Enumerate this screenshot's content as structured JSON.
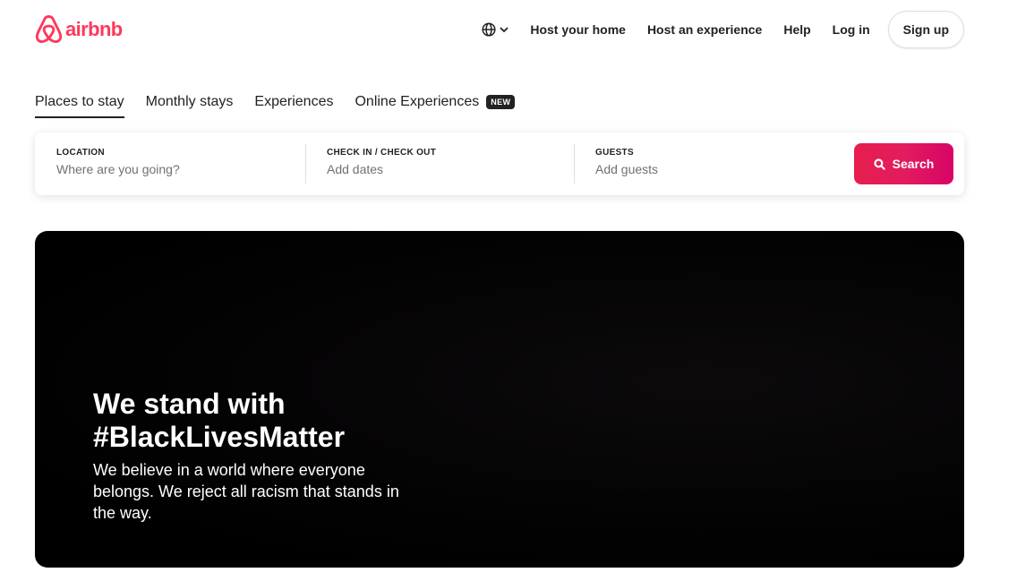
{
  "brand": {
    "name": "airbnb",
    "color": "#ff385c"
  },
  "header": {
    "language_icon": "globe-icon",
    "language_chevron_icon": "chevron-down-icon",
    "links": [
      "Host your home",
      "Host an experience",
      "Help",
      "Log in"
    ],
    "signup_label": "Sign up"
  },
  "tabs": {
    "items": [
      "Places to stay",
      "Monthly stays",
      "Experiences",
      "Online Experiences"
    ],
    "active": "Places to stay",
    "new_badge": "NEW"
  },
  "search": {
    "location": {
      "label": "LOCATION",
      "placeholder": "Where are you going?"
    },
    "dates": {
      "label": "CHECK IN / CHECK OUT",
      "placeholder": "Add dates"
    },
    "guests": {
      "label": "GUESTS",
      "placeholder": "Add guests"
    },
    "button_label": "Search",
    "button_icon": "search-icon",
    "accent": "#e61e4d"
  },
  "hero": {
    "title_line1": "We stand with",
    "title_line2": "#BlackLivesMatter",
    "body": "We believe in a world where everyone belongs. We reject all racism that stands in the way."
  }
}
